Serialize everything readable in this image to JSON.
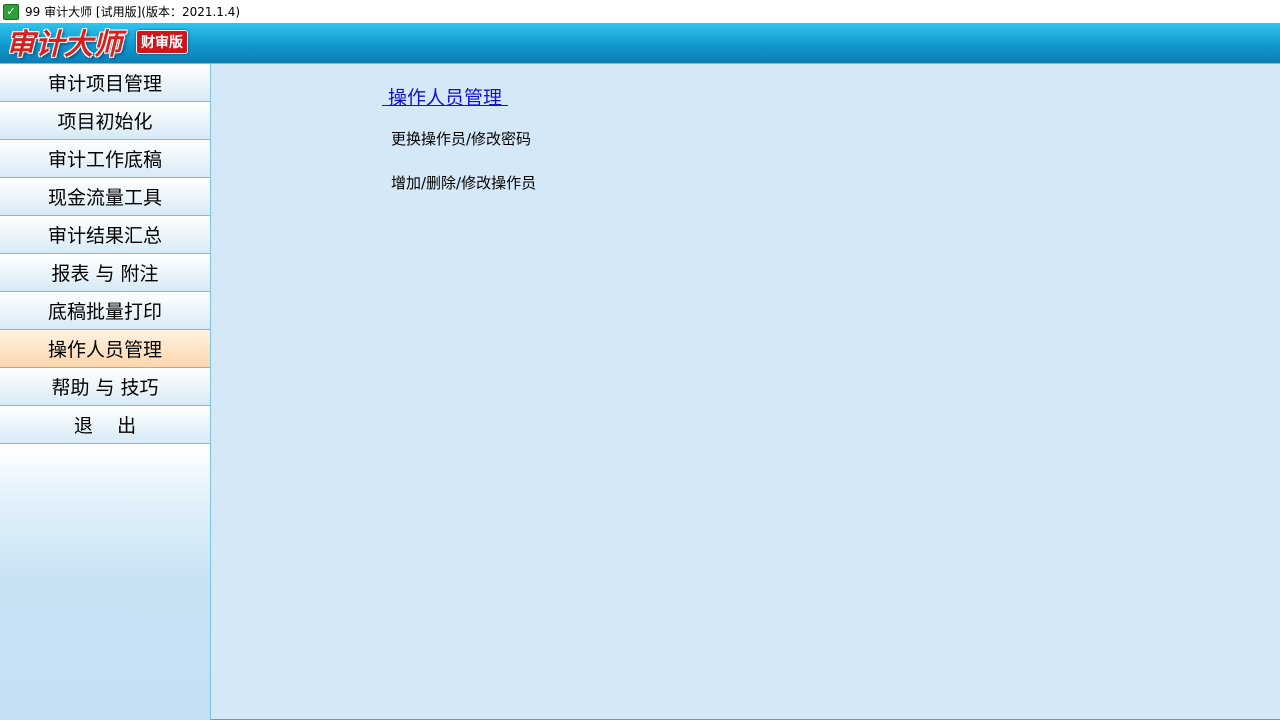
{
  "window": {
    "title": "99 审计大师 [试用版](版本：2021.1.4)"
  },
  "banner": {
    "logo_text": "审计大师",
    "edition_badge": "财审版"
  },
  "sidebar": {
    "items": [
      {
        "label": "审计项目管理",
        "active": false
      },
      {
        "label": "项目初始化",
        "active": false
      },
      {
        "label": "审计工作底稿",
        "active": false
      },
      {
        "label": "现金流量工具",
        "active": false
      },
      {
        "label": "审计结果汇总",
        "active": false
      },
      {
        "label": "报表 与 附注",
        "active": false
      },
      {
        "label": "底稿批量打印",
        "active": false
      },
      {
        "label": "操作人员管理",
        "active": true
      },
      {
        "label": "帮助 与 技巧",
        "active": false
      },
      {
        "label": "退    出",
        "active": false
      }
    ]
  },
  "main": {
    "section_title": " 操作人员管理 ",
    "links": [
      "更换操作员/修改密码",
      "增加/删除/修改操作员"
    ]
  },
  "colors": {
    "banner_blue": "#0f94c9",
    "content_bg": "#d5e8f8",
    "active_item": "#fde2c2",
    "link_blue": "#1010d8",
    "logo_red": "#d8201e"
  }
}
